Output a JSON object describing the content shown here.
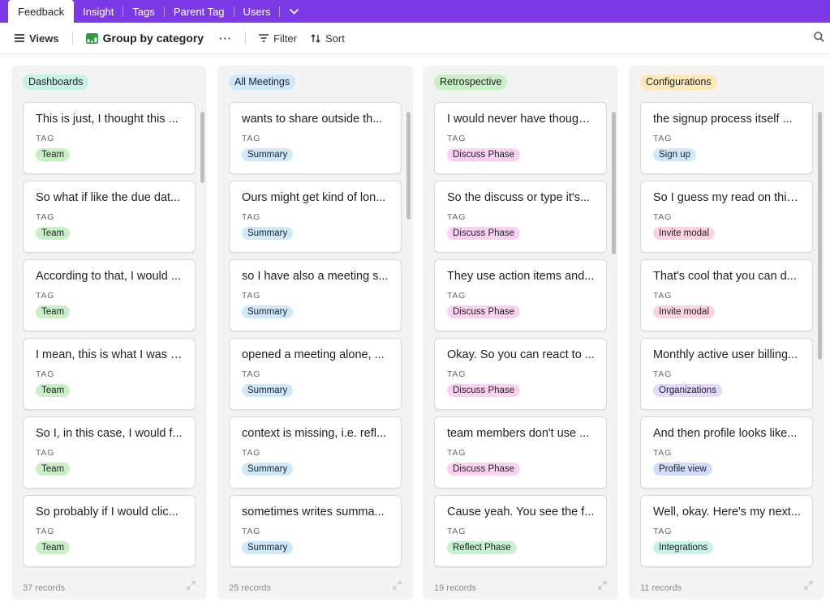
{
  "tabs": [
    {
      "label": "Feedback",
      "active": true
    },
    {
      "label": "Insight",
      "active": false
    },
    {
      "label": "Tags",
      "active": false
    },
    {
      "label": "Parent Tag",
      "active": false
    },
    {
      "label": "Users",
      "active": false
    }
  ],
  "toolbar": {
    "views_label": "Views",
    "group_label": "Group by category",
    "more_label": "···",
    "filter_label": "Filter",
    "sort_label": "Sort"
  },
  "colors": {
    "brand": "#7c3ae6",
    "tag_team": "#c8f0c4",
    "tag_summary": "#cfe9fb",
    "tag_discuss": "#fad2f0",
    "tag_reflect": "#c6f2cf",
    "tag_signup": "#cfe9fb",
    "tag_invite": "#fdd3dc",
    "tag_org": "#e4d8fb",
    "tag_profile": "#d2dcfb",
    "tag_integrations": "#c8f1e9"
  },
  "columns": [
    {
      "title": "Dashboards",
      "header_color": "#c6f1e6",
      "footer": "37 records",
      "cards": [
        {
          "title": "This is just, I thought this ...",
          "tag_label": "TAG",
          "tag": "Team",
          "tag_color": "#c8f0c4"
        },
        {
          "title": "So what if like the due dat...",
          "tag_label": "TAG",
          "tag": "Team",
          "tag_color": "#c8f0c4"
        },
        {
          "title": "According to that, I would ...",
          "tag_label": "TAG",
          "tag": "Team",
          "tag_color": "#c8f0c4"
        },
        {
          "title": "I mean, this is what I was t...",
          "tag_label": "TAG",
          "tag": "Team",
          "tag_color": "#c8f0c4"
        },
        {
          "title": "So I, in this case, I would f...",
          "tag_label": "TAG",
          "tag": "Team",
          "tag_color": "#c8f0c4"
        },
        {
          "title": "So probably if I would clic...",
          "tag_label": "TAG",
          "tag": "Team",
          "tag_color": "#c8f0c4"
        }
      ]
    },
    {
      "title": "All Meetings",
      "header_color": "#cfe9fb",
      "footer": "25 records",
      "cards": [
        {
          "title": "wants to share outside th...",
          "tag_label": "TAG",
          "tag": "Summary",
          "tag_color": "#cfe9fb"
        },
        {
          "title": "Ours might get kind of lon...",
          "tag_label": "TAG",
          "tag": "Summary",
          "tag_color": "#cfe9fb"
        },
        {
          "title": "so I have also a meeting s...",
          "tag_label": "TAG",
          "tag": "Summary",
          "tag_color": "#cfe9fb"
        },
        {
          "title": "opened a meeting alone, ...",
          "tag_label": "TAG",
          "tag": "Summary",
          "tag_color": "#cfe9fb"
        },
        {
          "title": "context is missing, i.e. refl...",
          "tag_label": "TAG",
          "tag": "Summary",
          "tag_color": "#cfe9fb"
        },
        {
          "title": "sometimes writes summa...",
          "tag_label": "TAG",
          "tag": "Summary",
          "tag_color": "#cfe9fb"
        }
      ]
    },
    {
      "title": "Retrospective",
      "header_color": "#c8f0c4",
      "footer": "19 records",
      "cards": [
        {
          "title": "I would never have though...",
          "tag_label": "TAG",
          "tag": "Discuss Phase",
          "tag_color": "#fad2f0"
        },
        {
          "title": "So the discuss or type it's...",
          "tag_label": "TAG",
          "tag": "Discuss Phase",
          "tag_color": "#fad2f0"
        },
        {
          "title": "They use action items and...",
          "tag_label": "TAG",
          "tag": "Discuss Phase",
          "tag_color": "#fad2f0"
        },
        {
          "title": "Okay. So you can react to ...",
          "tag_label": "TAG",
          "tag": "Discuss Phase",
          "tag_color": "#fad2f0"
        },
        {
          "title": "team members don't use ...",
          "tag_label": "TAG",
          "tag": "Discuss Phase",
          "tag_color": "#fad2f0"
        },
        {
          "title": "Cause yeah. You see the f...",
          "tag_label": "TAG",
          "tag": "Reflect Phase",
          "tag_color": "#c6f2cf"
        }
      ]
    },
    {
      "title": "Configurations",
      "header_color": "#fde9b8",
      "footer": "11 records",
      "cards": [
        {
          "title": "the signup process itself ...",
          "tag_label": "TAG",
          "tag": "Sign up",
          "tag_color": "#cfe9fb"
        },
        {
          "title": "So I guess my read on this...",
          "tag_label": "TAG",
          "tag": "Invite modal",
          "tag_color": "#fdd3dc"
        },
        {
          "title": "That's cool that you can d...",
          "tag_label": "TAG",
          "tag": "Invite modal",
          "tag_color": "#fdd3dc"
        },
        {
          "title": "Monthly active user billing...",
          "tag_label": "TAG",
          "tag": "Organizations",
          "tag_color": "#e4d8fb"
        },
        {
          "title": "And then profile looks like...",
          "tag_label": "TAG",
          "tag": "Profile view",
          "tag_color": "#d2dcfb"
        },
        {
          "title": "Well, okay. Here's my next...",
          "tag_label": "TAG",
          "tag": "Integrations",
          "tag_color": "#c8f1e9"
        }
      ]
    }
  ]
}
